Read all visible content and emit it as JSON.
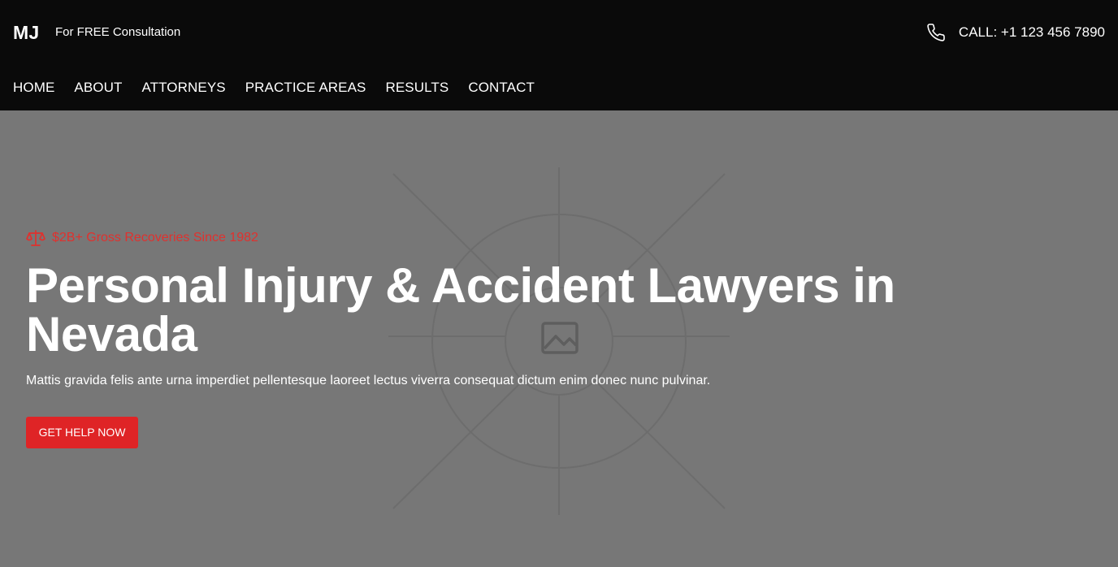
{
  "header": {
    "logo": "MJ",
    "tagline": "For FREE Consultation",
    "phone_label": "CALL: +1 123 456 7890",
    "phone_icon": "phone-icon"
  },
  "nav": {
    "items": [
      {
        "label": "HOME"
      },
      {
        "label": "ABOUT"
      },
      {
        "label": "ATTORNEYS"
      },
      {
        "label": "PRACTICE AREAS"
      },
      {
        "label": "RESULTS"
      },
      {
        "label": "CONTACT"
      }
    ]
  },
  "hero": {
    "badge_icon": "scale-icon",
    "badge_text": "$2B+ Gross Recoveries Since 1982",
    "title": "Personal Injury & Accident Lawyers in Nevada",
    "subtitle": "Mattis gravida felis ante urna imperdiet pellentesque laoreet lectus viverra consequat dictum enim donec nunc pulvinar.",
    "cta_label": "GET HELP NOW",
    "background_icon": "image-placeholder-icon"
  },
  "colors": {
    "header_bg": "#0a0a0a",
    "hero_bg": "#777777",
    "accent_red": "#df2426",
    "text_white": "#ffffff"
  }
}
